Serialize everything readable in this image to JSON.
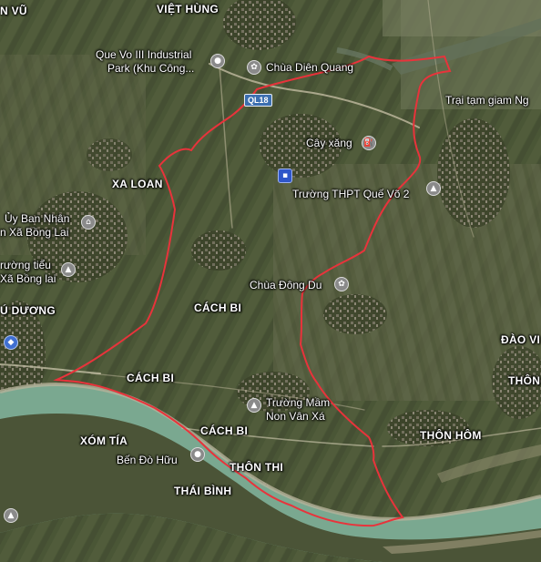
{
  "colors": {
    "boundary": "#e8333b",
    "river": "#7aa890",
    "river_edge": "#b5b19a",
    "poi_pin": "#8a8a8a",
    "transit_pin": "#2f56c9",
    "road_shield": "#3c6fb0"
  },
  "road_shield": "QL18",
  "labels": {
    "viet_hung": "VIỆT HÙNG",
    "an_vu": "N VŨ",
    "industrial_park_l1": "Que Vo III Industrial",
    "industrial_park_l2": "Park (Khu Công...",
    "chua_dien_quang": "Chùa Diên Quang",
    "trai_tam_giam": "Trại tạm giam Ng",
    "cay_xang": "Cây xăng",
    "truong_thpt": "Trường THPT Quế Võ 2",
    "xa_loan": "XA LOAN",
    "ubnd_l1": "Ủy Ban Nhân",
    "ubnd_l2": "n Xã Bồng Lai",
    "truong_tieu_l1": "rường tiểu",
    "truong_tieu_l2": "Xã Bồng lai",
    "u_duong": "Ú DƯƠNG",
    "chua_dong_du": "Chùa Đông Du",
    "cach_bi_1": "CÁCH BI",
    "cach_bi_2": "CÁCH BI",
    "cach_bi_3": "CÁCH BI",
    "dao_vien": "ĐÀO VI",
    "thon_right": "THÔN",
    "mam_non_l1": "Trường Mầm",
    "mam_non_l2": "Non Vân Xá",
    "thon_hom": "THÔN HÔM",
    "xom_tia": "XÓM TÍA",
    "ben_do_huu": "Bến Đò Hữu",
    "thon_thi": "THÔN THI",
    "thai_binh": "THÁI BÌNH"
  },
  "icons": {
    "industrial": "map-pin-icon",
    "temple": "buddhist-temple-icon",
    "gas": "gas-station-icon",
    "school": "school-cap-icon",
    "government": "government-building-icon",
    "bus": "bus-stop-icon",
    "shopping": "shopping-bag-icon"
  }
}
